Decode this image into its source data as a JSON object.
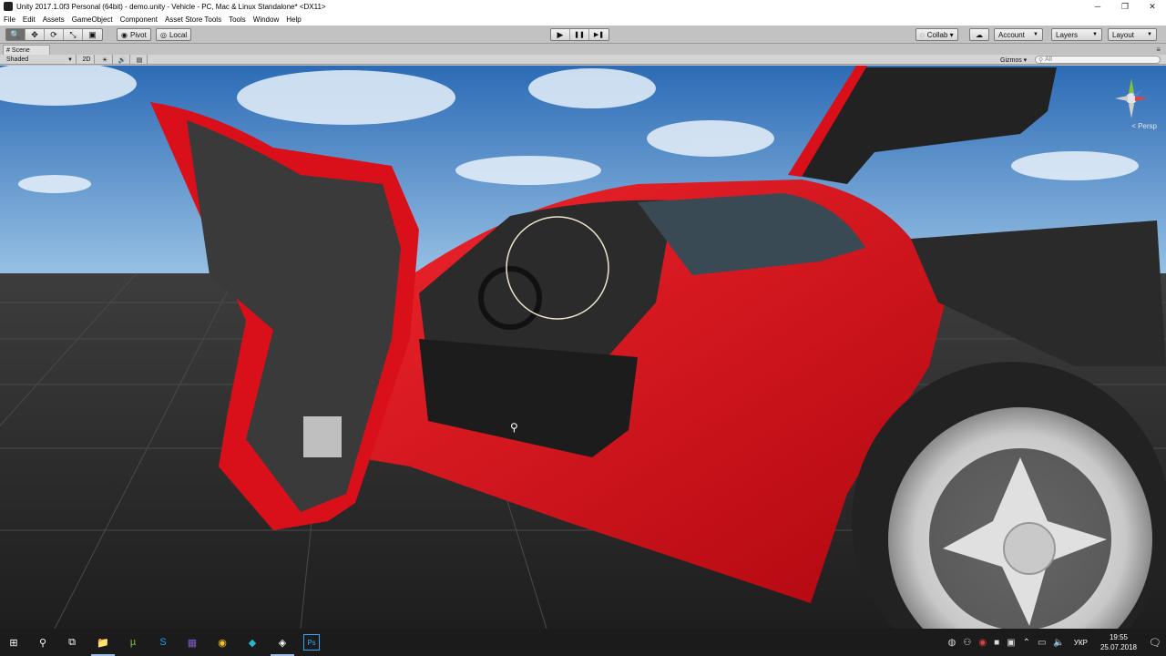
{
  "window": {
    "title": "Unity 2017.1.0f3 Personal (64bit) - demo.unity - Vehicle - PC, Mac & Linux Standalone* <DX11>",
    "minimize_glyph": "─",
    "maximize_glyph": "❐",
    "close_glyph": "✕"
  },
  "menu": [
    "File",
    "Edit",
    "Assets",
    "GameObject",
    "Component",
    "Asset Store Tools",
    "Tools",
    "Window",
    "Help"
  ],
  "toolbar": {
    "tools": [
      {
        "icon": "hand-icon",
        "glyph": "🔍"
      },
      {
        "icon": "move-icon",
        "glyph": "✥"
      },
      {
        "icon": "rotate-icon",
        "glyph": "⟳"
      },
      {
        "icon": "scale-icon",
        "glyph": "⤡"
      },
      {
        "icon": "rect-icon",
        "glyph": "▣"
      }
    ],
    "pivot_label": "Pivot",
    "local_label": "Local",
    "play_glyph": "▶",
    "pause_glyph": "❚❚",
    "step_glyph": "▶❚",
    "collab_label": "Collab ▾",
    "cloud_glyph": "☁",
    "account_label": "Account",
    "layers_label": "Layers",
    "layout_label": "Layout"
  },
  "scene": {
    "tab_label": "Scene",
    "shading_mode": "Shaded",
    "mode_2d": "2D",
    "light_glyph": "☀",
    "audio_glyph": "🔊",
    "effects_glyph": "▤",
    "gizmos_label": "Gizmos ▾",
    "search_placeholder": "All",
    "projection_label": "< Persp",
    "menu_glyph": "≡"
  },
  "colors": {
    "sky_top": "#2c6bb5",
    "sky_bottom": "#9cc4e6",
    "car_red": "#d9101a",
    "ground": "#2a2a2a"
  },
  "taskbar": {
    "start_glyph": "⊞",
    "apps": [
      {
        "name": "search-icon",
        "glyph": "⚲"
      },
      {
        "name": "task-view-icon",
        "glyph": "⧉"
      },
      {
        "name": "explorer-icon",
        "glyph": "📁"
      },
      {
        "name": "torrent-icon",
        "glyph": "µ"
      },
      {
        "name": "skype-icon",
        "glyph": "S"
      },
      {
        "name": "calendar-app-icon",
        "glyph": "▦"
      },
      {
        "name": "chrome-icon",
        "glyph": "◉"
      },
      {
        "name": "app-icon",
        "glyph": "◆"
      },
      {
        "name": "unity-icon",
        "glyph": "◈"
      },
      {
        "name": "photoshop-icon",
        "glyph": "Ps"
      }
    ],
    "language": "УКР",
    "time": "19:55",
    "date": "25.07.2018",
    "notification_glyph": "🗨"
  }
}
